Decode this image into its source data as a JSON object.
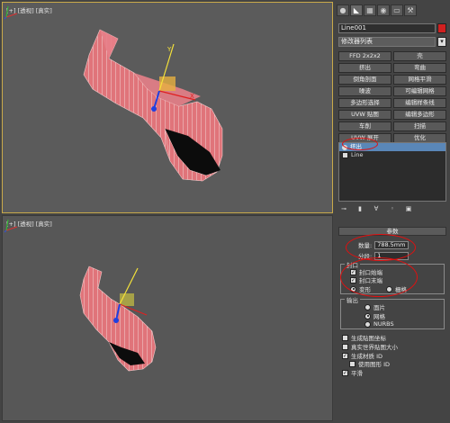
{
  "viewport_top": {
    "label": "[+] [透视] [真实]"
  },
  "viewport_bottom": {
    "label": "[+] [透视] [真实]"
  },
  "panel": {
    "tabs": [
      {
        "icon": "create-icon",
        "glyph": "●"
      },
      {
        "icon": "modify-icon",
        "glyph": "◣"
      },
      {
        "icon": "hierarchy-icon",
        "glyph": "▦"
      },
      {
        "icon": "motion-icon",
        "glyph": "◉"
      },
      {
        "icon": "display-icon",
        "glyph": "▭"
      },
      {
        "icon": "utilities-icon",
        "glyph": "⚒"
      }
    ],
    "object_name": "Line001",
    "swatch_color": "#d02020",
    "modifier_list": "修改器列表",
    "buttons": [
      "FFD 2x2x2",
      "壳",
      "挤出",
      "弯曲",
      "倒角剖面",
      "网格平滑",
      "噪波",
      "可编辑网格",
      "多边形选择",
      "编辑样条线",
      "UVW 贴图",
      "编辑多边形",
      "车削",
      "扫描",
      "UVW 展开",
      "优化"
    ],
    "stack": [
      {
        "label": "挤出",
        "selected": true
      },
      {
        "label": "Line",
        "selected": false
      }
    ],
    "params": {
      "header": "参数",
      "amount_label": "数量:",
      "amount_value": "788.5mm",
      "segments_label": "分段:",
      "segments_value": "1",
      "cap_title": "封口",
      "cap_start": "封口始端",
      "cap_end": "封口末端",
      "morph": "变形",
      "grid": "栅格",
      "output_title": "输出",
      "out_patch": "面片",
      "out_mesh": "网格",
      "out_nurbs": "NURBS",
      "gen_map": "生成贴图坐标",
      "real_world": "真实世界贴图大小",
      "gen_mat": "生成材质 ID",
      "use_shape": "使用图形 ID",
      "smooth": "平滑"
    },
    "accent": "#e01010"
  }
}
